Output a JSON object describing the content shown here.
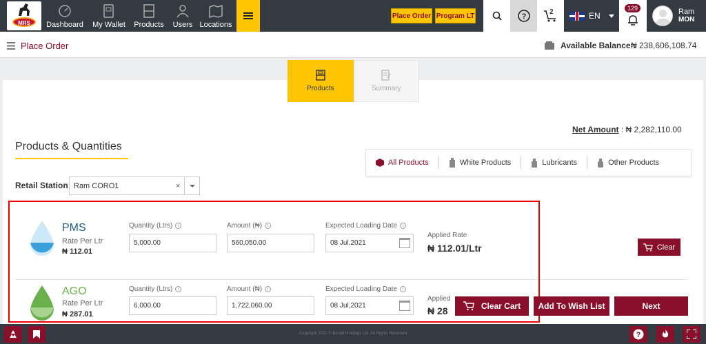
{
  "header": {
    "logo_text": "MRS",
    "nav": [
      {
        "label": "Dashboard",
        "icon": "dashboard-icon"
      },
      {
        "label": "My Wallet",
        "icon": "wallet-icon"
      },
      {
        "label": "Products",
        "icon": "products-icon"
      },
      {
        "label": "Users",
        "icon": "users-icon"
      },
      {
        "label": "Locations",
        "icon": "map-icon"
      }
    ],
    "place_order_label": "Place Order",
    "program_lt_label": "Program LT",
    "cart_count": "2",
    "language": "EN",
    "notification_count": "129",
    "user_first": "Ram",
    "user_last": "MON"
  },
  "breadcrumb": {
    "title": "Place Order",
    "balance_label": "Available Balance :",
    "balance_value": "₦ 238,606,108.74"
  },
  "steps": [
    {
      "label": "Products",
      "active": true
    },
    {
      "label": "Summary",
      "active": false
    }
  ],
  "net_amount": {
    "label": "Net Amount",
    "value": ": ₦ 2,282,110.00"
  },
  "section_title": "Products & Quantities",
  "product_tabs": [
    "All Products",
    "White Products",
    "Lubricants",
    "Other Products"
  ],
  "retail_station": {
    "label": "Retail Station",
    "value": "Ram CORO1"
  },
  "field_labels": {
    "quantity": "Quantity (Ltrs)",
    "amount": "Amount (₦)",
    "loading_date": "Expected Loading Date",
    "applied_rate": "Applied Rate",
    "rate_per_ltr": "Rate Per Ltr"
  },
  "products": [
    {
      "name": "PMS",
      "rate": "₦ 112.01",
      "quantity": "5,000.00",
      "amount": "560,050.00",
      "date": "08 Jul,2021",
      "applied_rate": "₦ 112.01/Ltr",
      "color": "#3aa0dc"
    },
    {
      "name": "AGO",
      "rate": "₦ 287.01",
      "quantity": "6,000.00",
      "amount": "1,722,060.00",
      "date": "08 Jul,2021",
      "applied_rate_label": "Applied",
      "applied_rate": "₦ 28",
      "color": "#6ab04c"
    }
  ],
  "clear_label": "Clear",
  "actions": {
    "clear_cart": "Clear Cart",
    "wish_list": "Add To Wish List",
    "next": "Next"
  },
  "footer": {
    "copyright": "Copyright 2021 © Bestaf Holdings Ltd. All Rights Reserved"
  },
  "colors": {
    "brand": "#8a0f2a",
    "accent": "#ffc600",
    "topbar": "#333a42"
  }
}
